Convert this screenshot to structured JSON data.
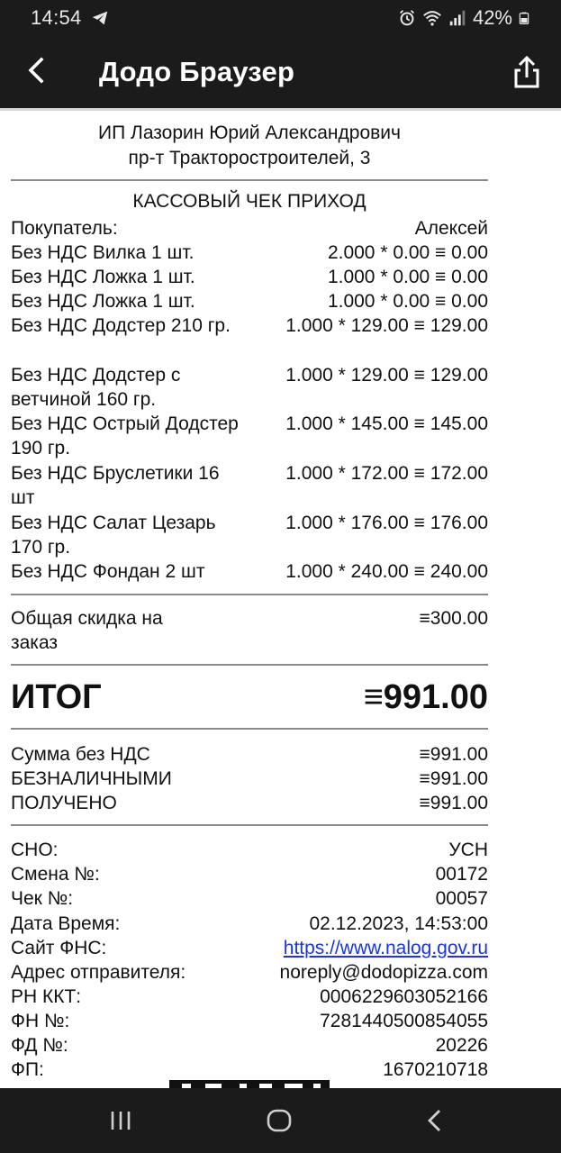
{
  "status_bar": {
    "time": "14:54",
    "battery": "42%",
    "icons": [
      "telegram-icon",
      "alarm-icon",
      "wifi-icon",
      "signal-icon",
      "battery-icon"
    ]
  },
  "app_bar": {
    "title": "Додо Браузер",
    "back_icon": "back-arrow-icon",
    "share_icon": "share-icon"
  },
  "receipt": {
    "seller_name": "ИП Лазорин Юрий Александрович",
    "seller_address": "пр-т Тракторостроителей, 3",
    "receipt_title": "КАССОВЫЙ ЧЕК ПРИХОД",
    "buyer_label": "Покупатель:",
    "buyer_value": "Алексей",
    "items": [
      {
        "name": "Без НДС Вилка 1 шт.",
        "calc": "2.000 * 0.00 ≡ 0.00"
      },
      {
        "name": "Без НДС Ложка 1 шт.",
        "calc": "1.000 * 0.00 ≡ 0.00"
      },
      {
        "name": "Без НДС Ложка 1 шт.",
        "calc": "1.000 * 0.00 ≡ 0.00"
      },
      {
        "name": "Без НДС Додстер 210 гр.",
        "calc": "1.000 * 129.00 ≡ 129.00"
      },
      {
        "name": "Без НДС Додстер с ветчиной 160 гр.",
        "calc": "1.000 * 129.00 ≡ 129.00"
      },
      {
        "name": "Без НДС Острый Додстер 190 гр.",
        "calc": "1.000 * 145.00 ≡ 145.00"
      },
      {
        "name": "Без НДС Бруслетики 16 шт",
        "calc": "1.000 * 172.00 ≡ 172.00"
      },
      {
        "name": "Без НДС Салат Цезарь 170 гр.",
        "calc": "1.000 * 176.00 ≡ 176.00"
      },
      {
        "name": "Без НДС Фондан 2 шт",
        "calc": "1.000 * 240.00 ≡ 240.00"
      }
    ],
    "discount_label": "Общая скидка на заказ",
    "discount_value": "≡300.00",
    "total_label": "ИТОГ",
    "total_value": "≡991.00",
    "sum_no_vat_label": "Сумма без НДС",
    "sum_no_vat_value": "≡991.00",
    "cashless_label": "БЕЗНАЛИЧНЫМИ",
    "cashless_value": "≡991.00",
    "received_label": "ПОЛУЧЕНО",
    "received_value": "≡991.00",
    "sno_label": "СНО:",
    "sno_value": "УСН",
    "shift_label": "Смена №:",
    "shift_value": "00172",
    "check_label": "Чек №:",
    "check_value": "00057",
    "datetime_label": "Дата Время:",
    "datetime_value": "02.12.2023, 14:53:00",
    "fns_label": "Сайт ФНС:",
    "fns_value": "https://www.nalog.gov.ru",
    "sender_label": "Адрес отправителя:",
    "sender_value": "noreply@dodopizza.com",
    "rn_label": "РН ККТ:",
    "rn_value": "0006229603052166",
    "fn_label": "ФН №:",
    "fn_value": "7281440500854055",
    "fd_label": "ФД №:",
    "fd_value": "20226",
    "fp_label": "ФП:",
    "fp_value": "1670210718"
  },
  "nav_bar": {
    "icons": [
      "recent-apps-icon",
      "home-icon",
      "back-icon"
    ]
  }
}
